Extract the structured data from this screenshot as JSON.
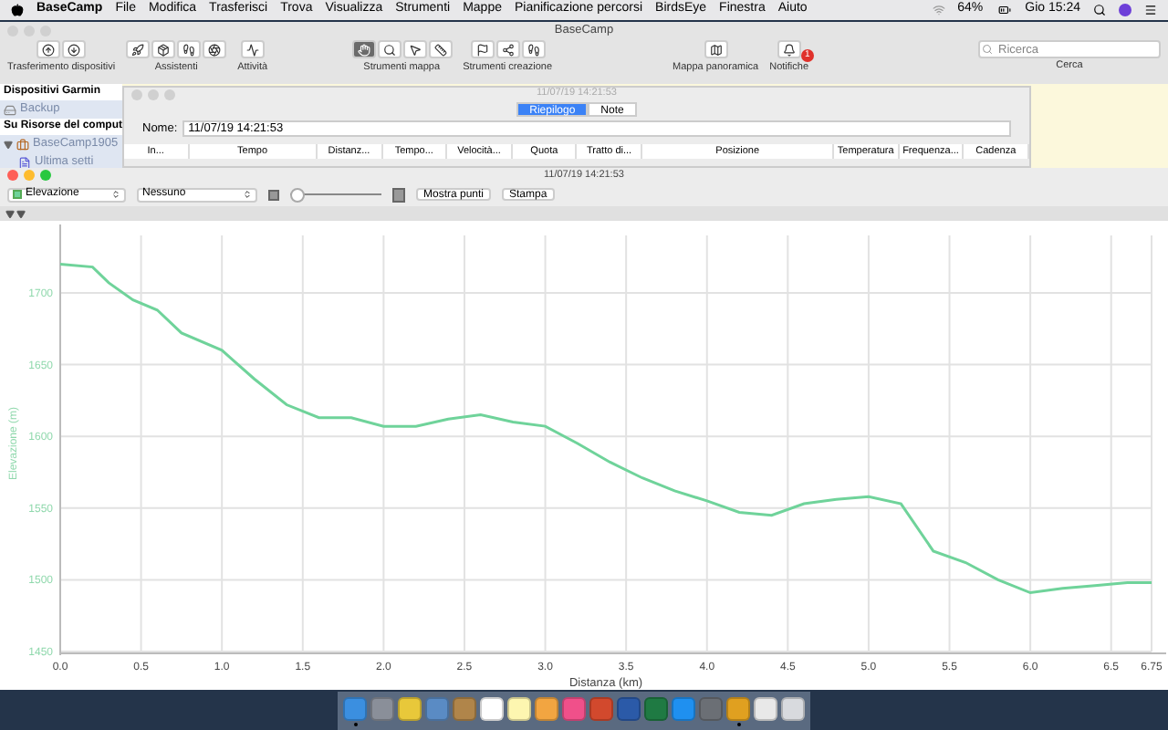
{
  "menubar": {
    "app": "BaseCamp",
    "items": [
      "File",
      "Modifica",
      "Trasferisci",
      "Trova",
      "Visualizza",
      "Strumenti",
      "Mappe",
      "Pianificazione percorsi",
      "BirdsEye",
      "Finestra",
      "Aiuto"
    ],
    "battery": "64%",
    "clock": "Gio 15:24"
  },
  "main_window": {
    "title": "BaseCamp",
    "toolbar": [
      {
        "label": "Trasferimento dispositivi",
        "tools": [
          {
            "selected": false
          },
          {
            "selected": false
          }
        ]
      },
      {
        "label": "Assistenti",
        "tools": [
          {
            "selected": false
          },
          {
            "selected": false
          },
          {
            "selected": false
          },
          {
            "selected": false
          }
        ]
      },
      {
        "label": "Attività",
        "tools": [
          {
            "selected": false
          }
        ]
      },
      {
        "label": "Strumenti mappa",
        "tools": [
          {
            "selected": true
          },
          {
            "selected": false
          },
          {
            "selected": false
          },
          {
            "selected": false
          }
        ]
      },
      {
        "label": "Strumenti creazione",
        "tools": [
          {
            "selected": false
          },
          {
            "selected": false
          },
          {
            "selected": false
          }
        ]
      },
      {
        "label": "Mappa panoramica",
        "tools": [
          {
            "selected": false
          }
        ]
      },
      {
        "label": "Notifiche",
        "tools": [
          {
            "selected": false
          }
        ],
        "badge": "1"
      }
    ],
    "search": {
      "placeholder": "Ricerca",
      "label": "Cerca"
    },
    "sidebar": [
      {
        "title": "Dispositivi Garmin",
        "items": [
          {
            "label": "Backup",
            "selected": false
          }
        ]
      },
      {
        "title": "Su Risorse del comput",
        "items": [
          {
            "label": "BaseCamp1905",
            "selected": false,
            "expanded": true,
            "children": [
              {
                "label": "Ultima setti",
                "selected": false
              }
            ]
          }
        ]
      }
    ]
  },
  "details_window": {
    "title": "11/07/19 14:21:53",
    "tabs": [
      {
        "label": "Riepilogo",
        "selected": true
      },
      {
        "label": "Note",
        "selected": false
      }
    ],
    "name_label": "Nome:",
    "name_value": "11/07/19 14:21:53",
    "columns": [
      "In...",
      "Tempo",
      "Distanz...",
      "Tempo...",
      "Velocità...",
      "Quota",
      "Tratto di...",
      "Posizione",
      "Temperatura",
      "Frequenza...",
      "Cadenza"
    ]
  },
  "profile_window": {
    "title": "11/07/19 14:21:53",
    "secondary_select": "Nessuno",
    "zoom": {
      "level": 0
    },
    "buttons": [
      "Mostra punti",
      "Stampa"
    ],
    "chart_data": {
      "type": "line",
      "xlabel": "Distanza (km)",
      "ylabel": "Elevazione (m)",
      "x": [
        0,
        0.2,
        0.3,
        0.45,
        0.6,
        0.75,
        1.0,
        1.2,
        1.4,
        1.6,
        1.8,
        2.0,
        2.2,
        2.4,
        2.6,
        2.8,
        3.0,
        3.2,
        3.4,
        3.6,
        3.8,
        4.0,
        4.2,
        4.4,
        4.6,
        4.8,
        5.0,
        5.2,
        5.4,
        5.6,
        5.8,
        6.0,
        6.2,
        6.4,
        6.6,
        6.75
      ],
      "series": [
        {
          "name": "Elevazione",
          "color": "#6fd39a",
          "values": [
            1720,
            1718,
            1707,
            1695,
            1688,
            1672,
            1660,
            1640,
            1622,
            1613,
            1613,
            1607,
            1607,
            1612,
            1615,
            1610,
            1607,
            1595,
            1582,
            1571,
            1562,
            1555,
            1547,
            1545,
            1553,
            1556,
            1558,
            1553,
            1520,
            1512,
            1500,
            1491,
            1494,
            1496,
            1498,
            1498
          ]
        }
      ],
      "xlim": [
        0,
        6.75
      ],
      "ylim": [
        1450,
        1740
      ],
      "xticks": [
        {
          "value": 0,
          "label": "0.0"
        },
        0.5,
        {
          "value": 1,
          "label": "1.0"
        },
        1.5,
        {
          "value": 2,
          "label": "2.0"
        },
        2.5,
        {
          "value": 3,
          "label": "3.0"
        },
        3.5,
        {
          "value": 4,
          "label": "4.0"
        },
        4.5,
        {
          "value": 5,
          "label": "5.0"
        },
        5.5,
        {
          "value": 6,
          "label": "6.0"
        },
        6.5,
        6.75
      ],
      "yticks": [
        1450,
        1500,
        1550,
        1600,
        1650,
        1700
      ],
      "grid": true
    }
  },
  "dock": {
    "apps": [
      {
        "color": "#3b8fe0",
        "running": true
      },
      {
        "color": "#8a8f99",
        "running": false
      },
      {
        "color": "#e8c83a",
        "running": false
      },
      {
        "color": "#5a8bc4",
        "running": false
      },
      {
        "color": "#b0854a",
        "running": false
      },
      {
        "color": "#ffffff",
        "running": false
      },
      {
        "color": "#fdf6b0",
        "running": false
      },
      {
        "color": "#f2a541",
        "running": false
      },
      {
        "color": "#f0508a",
        "running": false
      },
      {
        "color": "#d2492d",
        "running": false
      },
      {
        "color": "#2b5aa8",
        "running": false
      },
      {
        "color": "#1f7a43",
        "running": false
      },
      {
        "color": "#1f90f0",
        "running": false
      },
      {
        "color": "#6b6f75",
        "running": false
      },
      {
        "color": "#e0a020",
        "running": true
      },
      {
        "color": "#e8e8e8",
        "running": false
      },
      {
        "color": "#d8dade",
        "running": false
      }
    ]
  }
}
